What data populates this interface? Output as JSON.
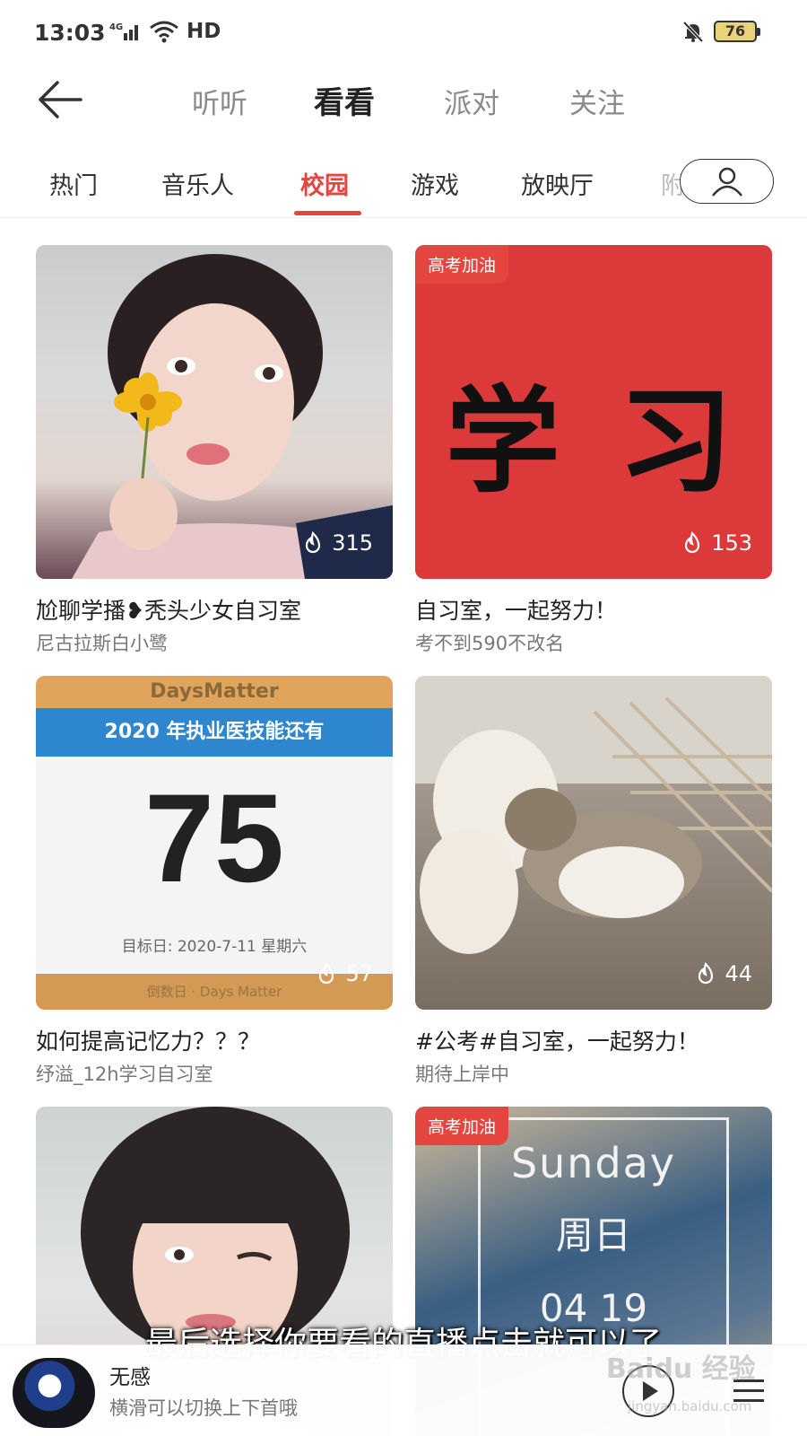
{
  "status_bar": {
    "time": "13:03",
    "network": "4G",
    "hd": "HD",
    "battery": "76"
  },
  "top_tabs": [
    {
      "label": "听听"
    },
    {
      "label": "看看"
    },
    {
      "label": "派对"
    },
    {
      "label": "关注"
    }
  ],
  "categories": [
    {
      "label": "热门"
    },
    {
      "label": "音乐人"
    },
    {
      "label": "校园"
    },
    {
      "label": "游戏"
    },
    {
      "label": "放映厅"
    },
    {
      "label": "附"
    }
  ],
  "cards": [
    {
      "title": "尬聊学播❥秃头少女自习室",
      "author": "尼古拉斯白小鹭",
      "heat": "315",
      "badge": ""
    },
    {
      "title": "自习室，一起努力！",
      "author": "考不到590不改名",
      "heat": "153",
      "badge": "高考加油",
      "cover_text": "学 习"
    },
    {
      "title": "如何提高记忆力？？？",
      "author": "纾溢_12h学习自习室",
      "heat": "57",
      "badge": "",
      "cover": {
        "app": "DaysMatter",
        "header": "2020 年执业医技能还有",
        "number": "75",
        "target": "目标日: 2020-7-11 星期六",
        "footer": "倒数日 · Days Matter"
      }
    },
    {
      "title": "#公考#自习室，一起努力！",
      "author": "期待上岸中",
      "heat": "44",
      "badge": ""
    },
    {
      "title": "",
      "author": "",
      "heat": "",
      "badge": ""
    },
    {
      "title": "",
      "author": "",
      "heat": "",
      "badge": "高考加油",
      "cover": {
        "line1": "Sunday",
        "line2": "周日",
        "line3": "04 19"
      }
    }
  ],
  "subtitle": "最后选择你要看的直播点击就可以了",
  "player": {
    "song": "无感",
    "hint": "横滑可以切换上下首哦"
  },
  "watermark": {
    "brand": "Baidu 经验",
    "url": "jingyan.baidu.com"
  },
  "colors": {
    "accent": "#e5453f",
    "text": "#222222",
    "muted": "#777777"
  }
}
